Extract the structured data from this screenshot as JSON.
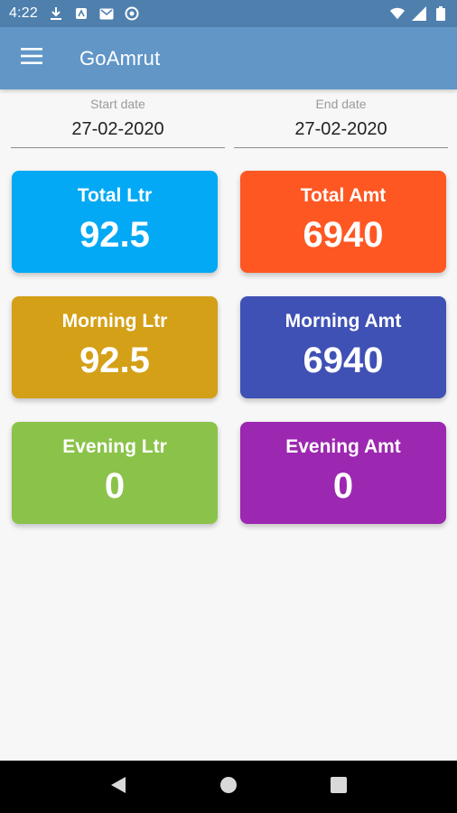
{
  "status_bar": {
    "time": "4:22",
    "icons_left": [
      "download-icon",
      "news-icon",
      "gmail-icon",
      "vpn-icon"
    ],
    "icons_right": [
      "wifi-icon",
      "signal-icon",
      "battery-icon"
    ]
  },
  "app_bar": {
    "title": "GoAmrut",
    "menu_icon": "hamburger-menu-icon"
  },
  "dates": {
    "start_label": "Start date",
    "start_value": "27-02-2020",
    "end_label": "End date",
    "end_value": "27-02-2020"
  },
  "cards": [
    {
      "label": "Total Ltr",
      "value": "92.5",
      "color": "#03a9f4"
    },
    {
      "label": "Total Amt",
      "value": "6940",
      "color": "#ff5722"
    },
    {
      "label": "Morning Ltr",
      "value": "92.5",
      "color": "#d4a017"
    },
    {
      "label": "Morning Amt",
      "value": "6940",
      "color": "#3f51b5"
    },
    {
      "label": "Evening Ltr",
      "value": "0",
      "color": "#8bc34a"
    },
    {
      "label": "Evening Amt",
      "value": "0",
      "color": "#9c27b0"
    }
  ],
  "nav_bar": {
    "back_icon": "back-triangle-icon",
    "home_icon": "home-circle-icon",
    "recents_icon": "recents-square-icon"
  },
  "colors": {
    "status_bar": "#4f80ad",
    "app_bar": "#6196c7",
    "background": "#f7f7f7"
  }
}
